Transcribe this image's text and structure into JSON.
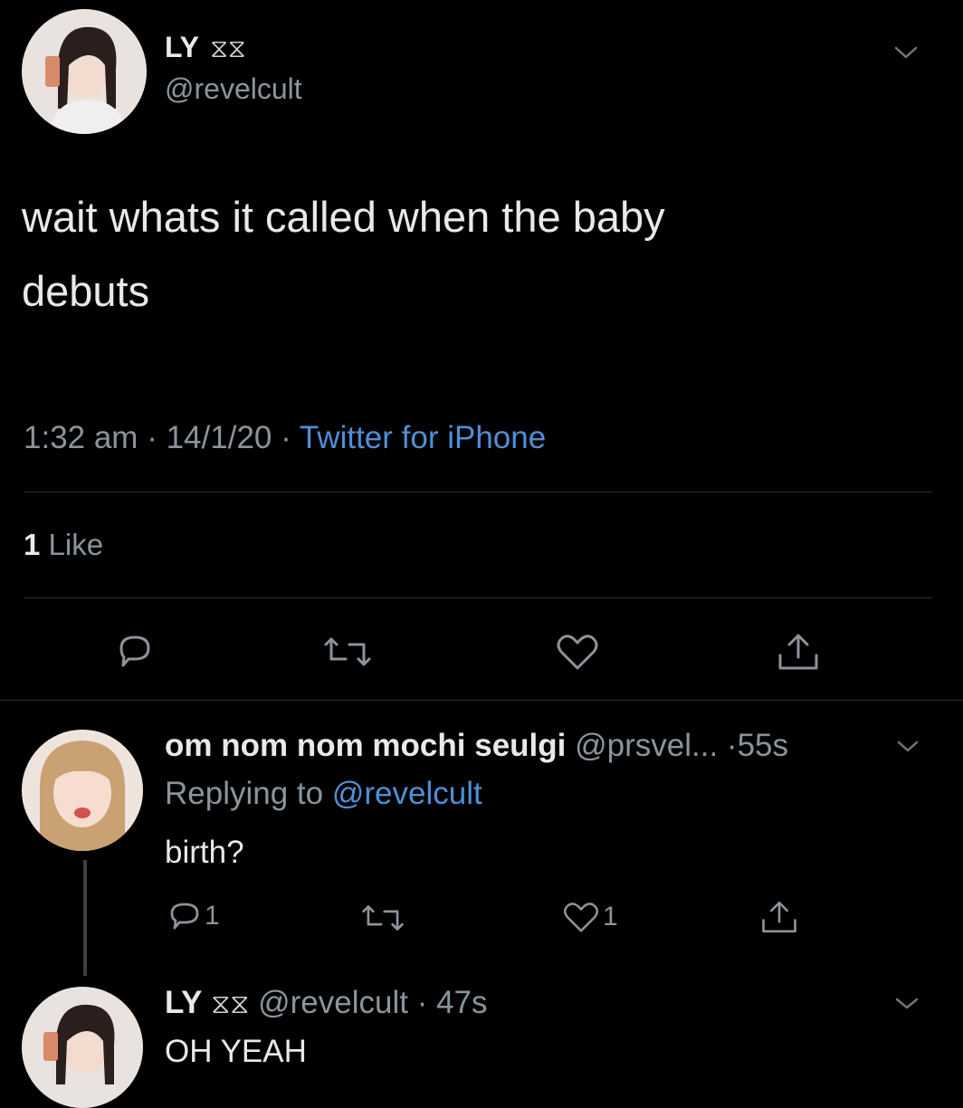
{
  "main_tweet": {
    "display_name": "LY",
    "name_emoji": "ꕥ",
    "handle": "@revelcult",
    "text_line1": "wait whats it called when the baby",
    "text_line2": "debuts",
    "time": "1:32 am",
    "date": "14/1/20",
    "source": "Twitter for iPhone",
    "sep": "·",
    "like_count": "1",
    "like_label": "Like"
  },
  "reply1": {
    "display_name": "om nom nom mochi seulgi",
    "handle": "@prsvel...",
    "age": "·55s",
    "replying_label": "Replying to",
    "replying_handle": "@revelcult",
    "text": "birth?",
    "reply_count": "1",
    "like_count": "1"
  },
  "reply2": {
    "display_name": "LY",
    "name_emoji": "ꕥ",
    "handle": "@revelcult",
    "age": "· 47s",
    "text": "OH YEAH"
  },
  "colors": {
    "background": "#000000",
    "text": "#e7e9ea",
    "muted": "#8b949b",
    "link": "#4f8fd6"
  }
}
